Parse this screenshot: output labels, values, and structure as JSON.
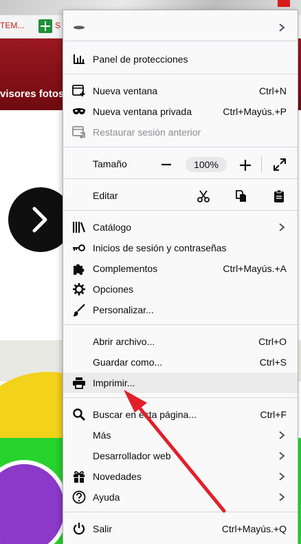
{
  "background": {
    "bookmark1": "TEM...",
    "bookmark2": "S",
    "banner_text": "visores fotos"
  },
  "menu": {
    "account": {
      "icon": "account-icon"
    },
    "protections": {
      "label": "Panel de protecciones",
      "icon": "chart-icon"
    },
    "new_window": {
      "label": "Nueva ventana",
      "shortcut": "Ctrl+N",
      "icon": "new-window-icon"
    },
    "private_window": {
      "label": "Nueva ventana privada",
      "shortcut": "Ctrl+Mayús.+P",
      "icon": "mask-icon"
    },
    "restore_session": {
      "label": "Restaurar sesión anterior",
      "icon": "restore-icon",
      "disabled": true
    },
    "zoom": {
      "label": "Tamaño",
      "value": "100%"
    },
    "edit": {
      "label": "Editar"
    },
    "library": {
      "label": "Catálogo",
      "icon": "library-icon"
    },
    "logins": {
      "label": "Inicios de sesión y contraseñas",
      "icon": "key-icon"
    },
    "addons": {
      "label": "Complementos",
      "shortcut": "Ctrl+Mayús.+A",
      "icon": "puzzle-icon"
    },
    "options": {
      "label": "Opciones",
      "icon": "gear-icon"
    },
    "customize": {
      "label": "Personalizar...",
      "icon": "brush-icon"
    },
    "open_file": {
      "label": "Abrir archivo...",
      "shortcut": "Ctrl+O"
    },
    "save_as": {
      "label": "Guardar como...",
      "shortcut": "Ctrl+S"
    },
    "print": {
      "label": "Imprimir...",
      "icon": "printer-icon"
    },
    "find": {
      "label": "Buscar en esta página...",
      "shortcut": "Ctrl+F",
      "icon": "search-icon"
    },
    "more": {
      "label": "Más"
    },
    "web_dev": {
      "label": "Desarrollador web"
    },
    "whats_new": {
      "label": "Novedades",
      "icon": "gift-icon"
    },
    "help": {
      "label": "Ayuda",
      "icon": "help-icon"
    },
    "quit": {
      "label": "Salir",
      "shortcut": "Ctrl+Mayús.+Q",
      "icon": "power-icon"
    }
  },
  "colors": {
    "annotation_arrow": "#e3202a",
    "menu_bg": "#f9f9fa",
    "hover_bg": "#ebebec"
  }
}
